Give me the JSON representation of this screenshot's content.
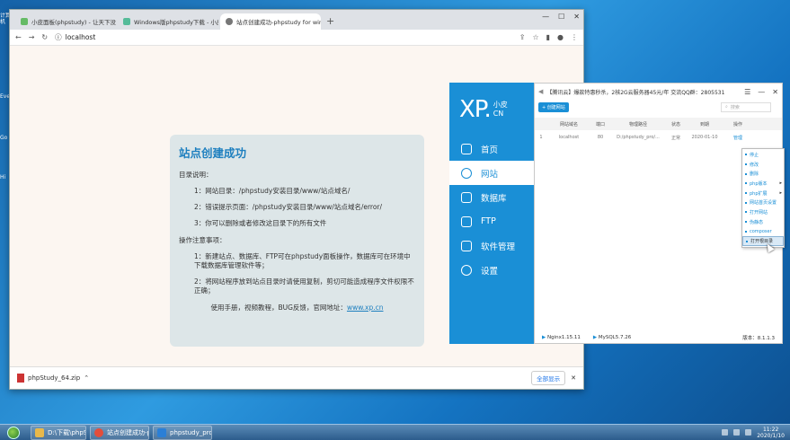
{
  "desktop": {
    "icons": [
      "计算机",
      "Eve",
      "Go",
      "Hi"
    ]
  },
  "browser": {
    "tabs": [
      {
        "label": "小皮面板(phpstudy) - 让天下没有",
        "active": false
      },
      {
        "label": "Windows版phpstudy下载 - 小皮",
        "active": false
      },
      {
        "label": "站点创建成功-phpstudy for win",
        "active": true
      }
    ],
    "new_tab": "+",
    "address": "localhost",
    "download": {
      "file": "phpStudy_64.zip",
      "show_all": "全部显示"
    }
  },
  "card": {
    "title": "站点创建成功",
    "dir_heading": "目录说明：",
    "dir_items": [
      "1：网站目录：/phpstudy安装目录/www/站点域名/",
      "2：错误提示页面：/phpstudy安装目录/www/站点域名/error/",
      "3：你可以删除或者修改这目录下的所有文件"
    ],
    "ops_heading": "操作注意事项：",
    "ops_items": [
      "1：新建站点、数据库、FTP可在phpstudy面板操作，数据库可在环境中下载数据库管理软件等；",
      "2：将网站程序放到站点目录时请使用复制，剪切可能造成程序文件权限不正确；"
    ],
    "manual_prefix": "使用手册，视频教程，BUG反馈，官网地址：",
    "manual_link": "www.xp.cn"
  },
  "phpstudy": {
    "logo_big": "XP.",
    "logo_small_top": "小皮",
    "logo_small_bottom": "CN",
    "nav": [
      {
        "label": "首页",
        "icon": "home-icon",
        "active": false
      },
      {
        "label": "网站",
        "icon": "globe-icon",
        "active": true
      },
      {
        "label": "数据库",
        "icon": "database-icon",
        "active": false
      },
      {
        "label": "FTP",
        "icon": "server-icon",
        "active": false
      },
      {
        "label": "软件管理",
        "icon": "sliders-icon",
        "active": false
      },
      {
        "label": "设置",
        "icon": "gear-icon",
        "active": false
      }
    ],
    "notice": "【腾讯云】爆款特惠秒杀，2核2G云服务器45元/年 交流QQ群：2805531",
    "create_btn": "+ 创建网站",
    "search_placeholder": "搜索",
    "columns": [
      "",
      "网站域名",
      "端口",
      "物理路径",
      "状态",
      "到期",
      "操作"
    ],
    "rows": [
      [
        "1",
        "localhost",
        "80",
        "D:/phpstudy_pro/...",
        "正常",
        "2020-01-10",
        "管理"
      ]
    ],
    "context_menu": [
      {
        "label": "停止",
        "sub": false
      },
      {
        "label": "修改",
        "sub": false
      },
      {
        "label": "删除",
        "sub": false
      },
      {
        "label": "php版本",
        "sub": true
      },
      {
        "label": "php扩展",
        "sub": true
      },
      {
        "label": "网站首页设置",
        "sub": false
      },
      {
        "label": "打开网站",
        "sub": false
      },
      {
        "label": "伪静态",
        "sub": false
      },
      {
        "label": "composer",
        "sub": false
      },
      {
        "label": "打开根目录",
        "sub": false,
        "highlighted": true
      }
    ],
    "status": {
      "nginx": "Nginx1.15.11",
      "mysql": "MySQL5.7.26",
      "version": "版本：8.1.1.3"
    }
  },
  "taskbar": {
    "items": [
      {
        "label": "D:\\下载\\phpStud...",
        "color": "#e8b84a"
      },
      {
        "label": "站点创建成功-ph...",
        "color": "#e44d3a"
      },
      {
        "label": "phpstudy_pro",
        "color": "#2b7fd6"
      }
    ],
    "time": "11:22",
    "date": "2020/1/10"
  },
  "colors": {
    "accent": "#1a8fd6",
    "title": "#1d7fbf"
  }
}
